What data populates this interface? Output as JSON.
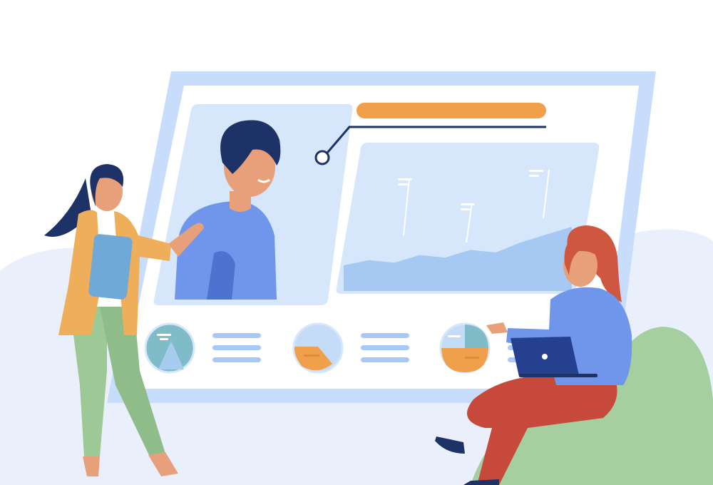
{
  "colors": {
    "background": "#ffffff",
    "backdrop_blob": "#e9f0fb",
    "board_frame": "#c8dcfb",
    "board_inner": "#ffffff",
    "panel": "#d6e6fb",
    "accent_orange": "#f0a04b",
    "navy": "#1d3266",
    "blue": "#6f96eb",
    "blue_dark": "#4c73cf",
    "light_line": "#a8c9f7",
    "skin": "#e8a07a",
    "green_pants": "#9cc995",
    "green_seat": "#a6cfa0",
    "jacket": "#eeae5a",
    "red_pants": "#c7493b",
    "red_hair": "#d0573f",
    "laptop": "#24408f"
  },
  "icons": {
    "connector": "connector-node-icon",
    "chart_a": "mountain-chart-icon",
    "chart_b": "half-fill-chart-icon",
    "chart_c": "pie-quarter-chart-icon"
  },
  "chart_data": {
    "type": "area",
    "series": [
      {
        "values": [
          10,
          12,
          11,
          14,
          13,
          16,
          15,
          19,
          22,
          25
        ]
      }
    ]
  }
}
